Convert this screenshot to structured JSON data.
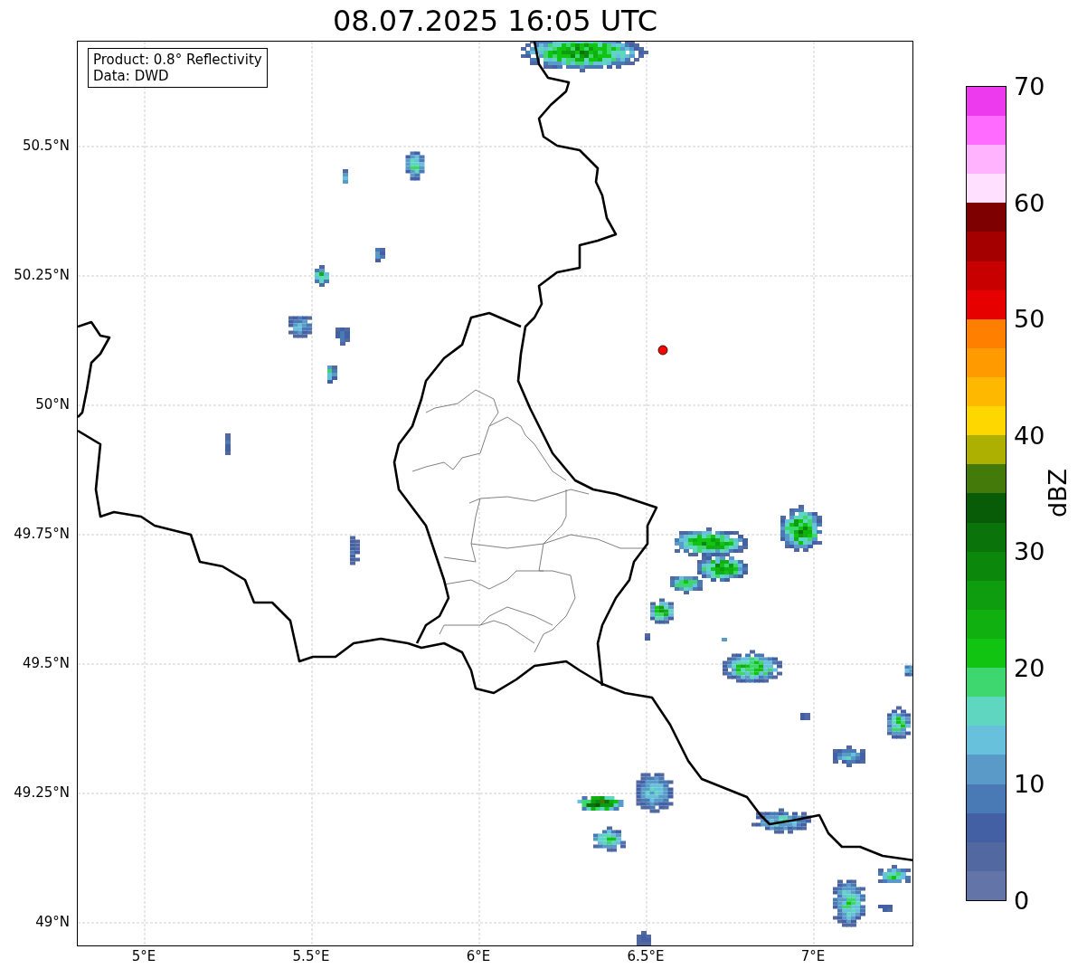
{
  "title": "08.07.2025 16:05 UTC",
  "legend": {
    "lines": [
      "Product: 0.8° Reflectivity",
      "Data: DWD"
    ]
  },
  "map": {
    "lat_ticks": [
      "50.5°N",
      "50.25°N",
      "50°N",
      "49.75°N",
      "49.5°N",
      "49.25°N",
      "49°N"
    ],
    "lon_ticks": [
      "5°E",
      "5.5°E",
      "6°E",
      "6.5°E",
      "7°E"
    ]
  },
  "colorbar": {
    "label": "dBZ",
    "ticks": [
      "70",
      "60",
      "50",
      "40",
      "30",
      "20",
      "10",
      "0"
    ],
    "bins": [
      {
        "color": "#6374a8"
      },
      {
        "color": "#5268a0"
      },
      {
        "color": "#4460a5"
      },
      {
        "color": "#4a7ab5"
      },
      {
        "color": "#5a9ac8"
      },
      {
        "color": "#67c0dc"
      },
      {
        "color": "#5ed6c0"
      },
      {
        "color": "#3dd66f"
      },
      {
        "color": "#11c411"
      },
      {
        "color": "#10b010"
      },
      {
        "color": "#0e9d0e"
      },
      {
        "color": "#0b870b"
      },
      {
        "color": "#0a740a"
      },
      {
        "color": "#085c08"
      },
      {
        "color": "#437a0a"
      },
      {
        "color": "#adb000"
      },
      {
        "color": "#ffd700"
      },
      {
        "color": "#ffb800"
      },
      {
        "color": "#ff9a00"
      },
      {
        "color": "#ff7f00"
      },
      {
        "color": "#e60000"
      },
      {
        "color": "#c80000"
      },
      {
        "color": "#a50000"
      },
      {
        "color": "#7f0000"
      },
      {
        "color": "#ffe0ff"
      },
      {
        "color": "#ffb3ff"
      },
      {
        "color": "#ff6bff"
      },
      {
        "color": "#ee3aee"
      }
    ]
  }
}
